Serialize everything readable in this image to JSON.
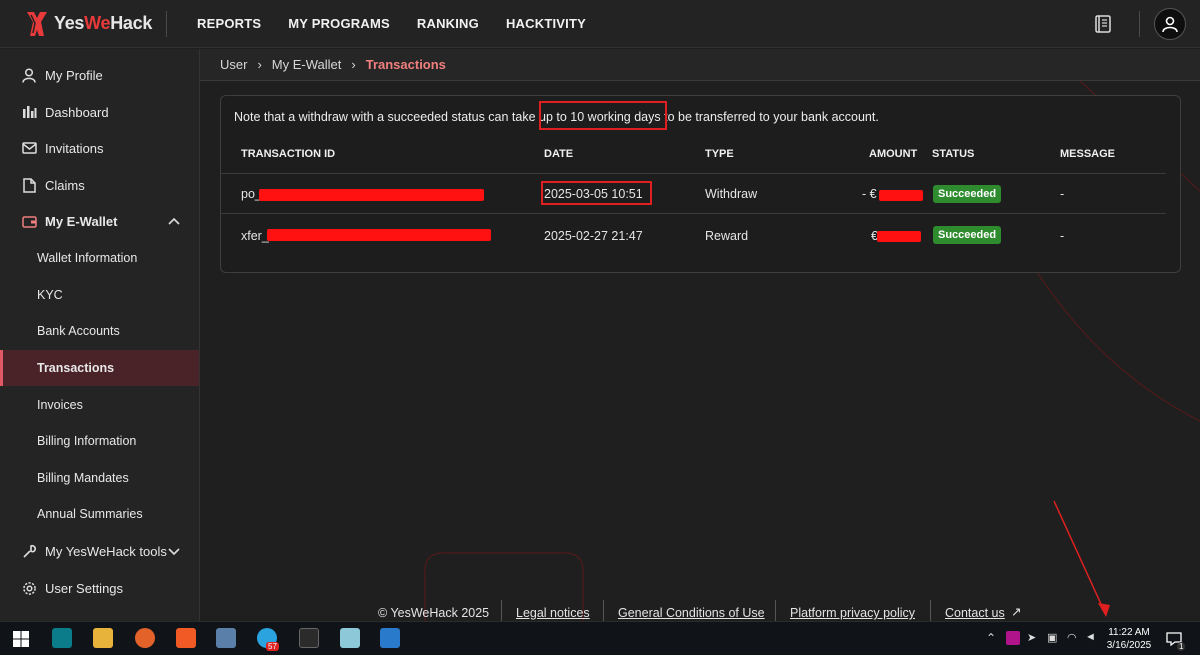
{
  "brand": {
    "name_part1": "Yes",
    "name_part2": "We",
    "name_part3": "Hack",
    "accent": "#e83a3a"
  },
  "nav": {
    "items": [
      "REPORTS",
      "MY PROGRAMS",
      "RANKING",
      "HACKTIVITY"
    ]
  },
  "sidebar": {
    "items": [
      {
        "label": "My Profile",
        "icon": "user-icon"
      },
      {
        "label": "Dashboard",
        "icon": "chart-icon"
      },
      {
        "label": "Invitations",
        "icon": "mail-icon"
      },
      {
        "label": "Claims",
        "icon": "document-icon"
      },
      {
        "label": "My E-Wallet",
        "icon": "wallet-icon"
      },
      {
        "label": "Wallet Information"
      },
      {
        "label": "KYC"
      },
      {
        "label": "Bank Accounts"
      },
      {
        "label": "Transactions"
      },
      {
        "label": "Invoices"
      },
      {
        "label": "Billing Information"
      },
      {
        "label": "Billing Mandates"
      },
      {
        "label": "Annual Summaries"
      },
      {
        "label": "My YesWeHack tools",
        "icon": "wrench-icon"
      },
      {
        "label": "User Settings",
        "icon": "gear-icon"
      }
    ],
    "active_item": "Transactions"
  },
  "breadcrumb": {
    "items": [
      "User",
      "My E-Wallet",
      "Transactions"
    ]
  },
  "note": {
    "before": "Note that a withdraw with a succeeded status can take ",
    "highlight": "up to 10 working days",
    "after": " to be transferred to your bank account."
  },
  "table": {
    "headers": [
      "TRANSACTION ID",
      "DATE",
      "TYPE",
      "AMOUNT",
      "STATUS",
      "MESSAGE"
    ],
    "rows": [
      {
        "id_prefix": "po_",
        "date": "2025-03-05 10:51",
        "type": "Withdraw",
        "amount_prefix": "- €",
        "status": "Succeeded",
        "message": "-"
      },
      {
        "id_prefix": "xfer_",
        "date": "2025-02-27 21:47",
        "type": "Reward",
        "amount_prefix": "€",
        "status": "Succeeded",
        "message": "-"
      }
    ]
  },
  "footer": {
    "copyright": "© YesWeHack 2025",
    "links": [
      "Legal notices",
      "General Conditions of Use",
      "Platform privacy policy",
      "Contact us"
    ]
  },
  "taskbar": {
    "time": "11:22 AM",
    "date": "3/16/2025",
    "telegram_badge": "57",
    "notification_count": "1"
  },
  "colors": {
    "success": "#2e8b2e",
    "active_bg": "#4a2328",
    "redaction": "#ff1111",
    "annotation": "#e02020"
  }
}
